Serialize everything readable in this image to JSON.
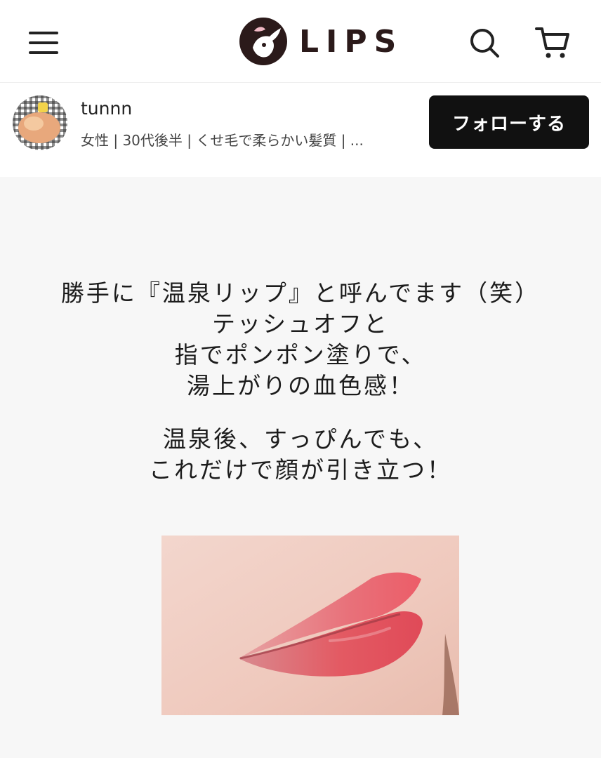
{
  "header": {
    "logo_text": "LIPS",
    "menu_icon": "hamburger-menu-icon",
    "search_icon": "search-icon",
    "cart_icon": "cart-icon"
  },
  "profile": {
    "username": "tunnn",
    "description": "女性 | 30代後半 | くせ毛で柔らかい髪質 | ...",
    "follow_label": "フォローする"
  },
  "post": {
    "caption_lines_1": [
      "勝手に『温泉リップ』と呼んでます（笑）",
      "テッシュオフと",
      "指でポンポン塗りで、",
      "湯上がりの血色感！"
    ],
    "caption_lines_2": [
      "温泉後、すっぴんでも、",
      "これだけで顔が引き立つ！"
    ]
  },
  "colors": {
    "brand_dark": "#2b1a1a",
    "follow_button_bg": "#111111",
    "post_bg": "#f7f7f7",
    "lip_color": "#e35a63"
  }
}
